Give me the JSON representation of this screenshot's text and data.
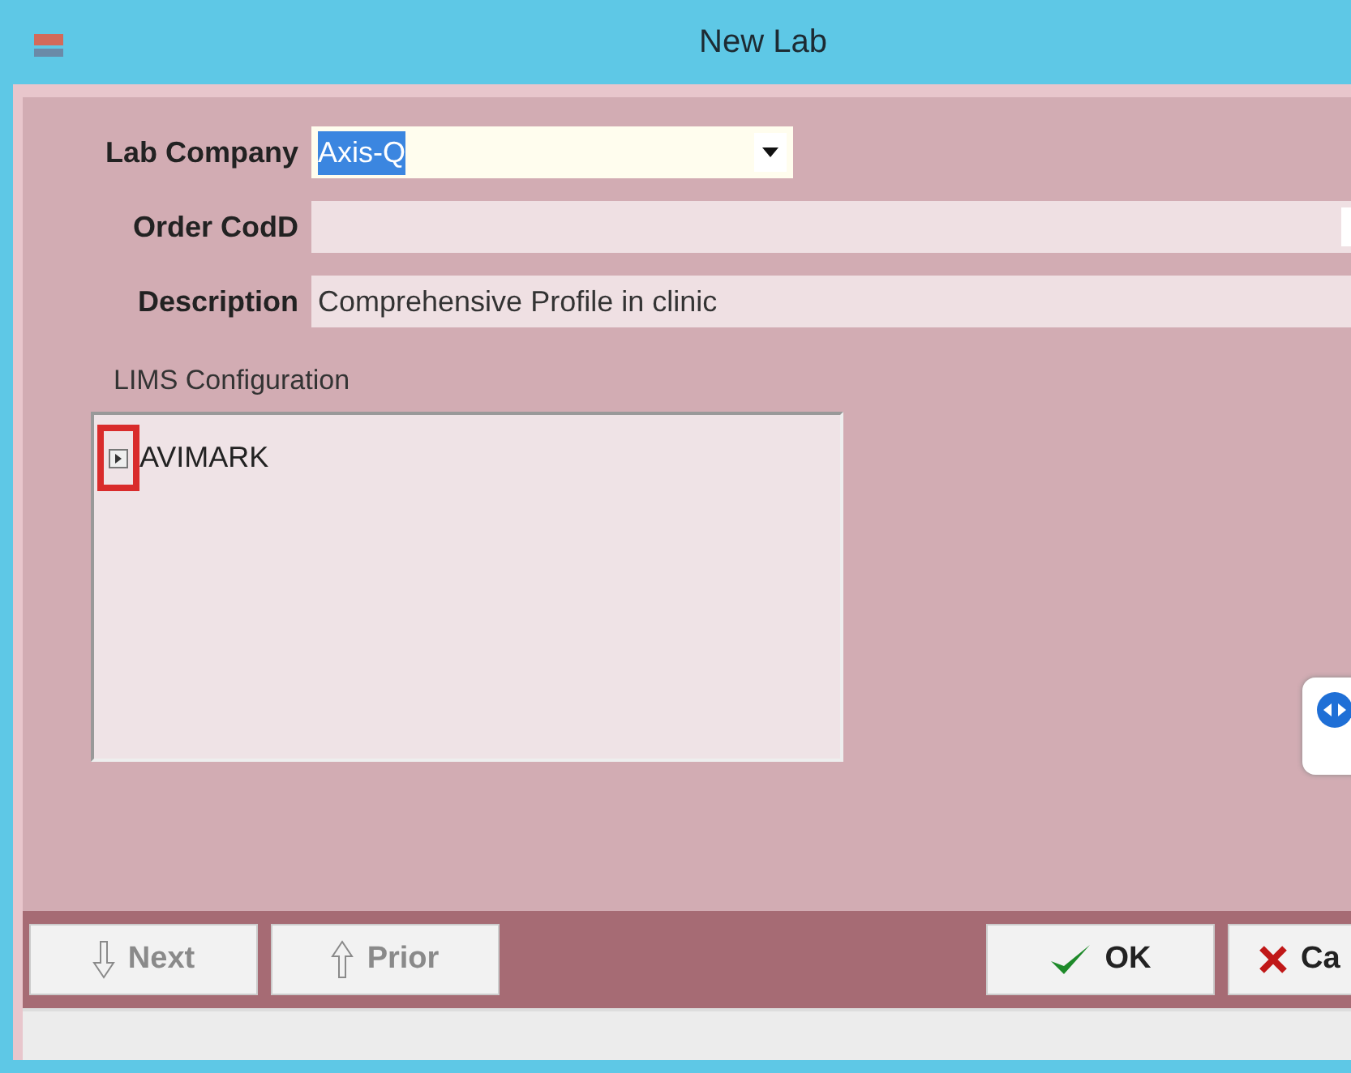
{
  "window": {
    "title": "New Lab"
  },
  "fields": [
    {
      "label": "Lab Company",
      "kind": "combo",
      "value": "Axis-Q",
      "value_selected": true
    },
    {
      "label": "Order CodD",
      "kind": "combo_cut"
    },
    {
      "label": "Description",
      "kind": "text",
      "value": "Comprehensive Profile in clinic"
    }
  ],
  "lims": {
    "label": "LIMS Configuration",
    "items": [
      {
        "label": "AVIMARK",
        "expanded": false,
        "highlighted": true
      }
    ]
  },
  "nav_buttons": [
    {
      "label": "Next",
      "kind": "down",
      "disabled": true
    },
    {
      "label": "Prior",
      "kind": "up",
      "disabled": true
    }
  ],
  "action_buttons": [
    {
      "label": "OK",
      "kind": "check"
    },
    {
      "label": "Ca",
      "kind": "cross"
    }
  ]
}
